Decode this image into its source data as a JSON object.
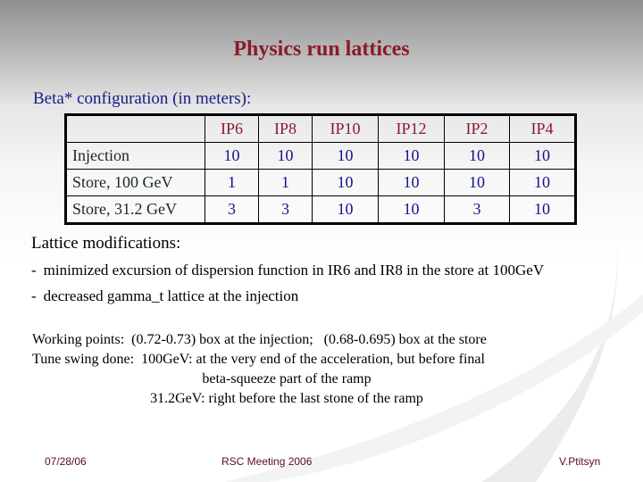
{
  "slide": {
    "title": "Physics run lattices",
    "subtitle": "Beta* configuration (in meters):",
    "table": {
      "headers": [
        "",
        "IP6",
        "IP8",
        "IP10",
        "IP12",
        "IP2",
        "IP4"
      ],
      "rows": [
        {
          "label": "Injection",
          "values": [
            "10",
            "10",
            "10",
            "10",
            "10",
            "10"
          ]
        },
        {
          "label": "Store, 100 GeV",
          "values": [
            "1",
            "1",
            "10",
            "10",
            "10",
            "10"
          ]
        },
        {
          "label": "Store, 31.2 GeV",
          "values": [
            "3",
            "3",
            "10",
            "10",
            "3",
            "10"
          ]
        }
      ]
    },
    "modifications": {
      "heading": "Lattice modifications:",
      "bullet": "-",
      "items": [
        "minimized excursion of dispersion function in IR6 and IR8 in the store at 100GeV",
        "decreased gamma_t lattice at the injection"
      ]
    },
    "working_points": {
      "line1": "Working points:  (0.72-0.73) box at the injection;   (0.68-0.695) box at the store",
      "line2": "Tune swing done:  100GeV: at the very end of the acceleration, but before final",
      "line3": "beta-squeeze part of the ramp",
      "line4": "31.2GeV: right before the last stone of the ramp"
    },
    "footer": {
      "date": "07/28/06",
      "event": "RSC Meeting 2006",
      "author": "V.Ptitsyn"
    }
  }
}
